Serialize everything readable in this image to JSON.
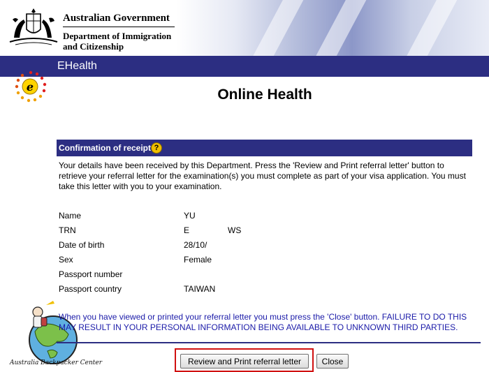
{
  "header": {
    "gov_title": "Australian Government",
    "dept_line1": "Department of Immigration",
    "dept_line2": "and Citizenship"
  },
  "nav": {
    "app_name": "EHealth"
  },
  "page": {
    "title": "Online Health"
  },
  "section": {
    "title": "Confirmation of receipt",
    "help_glyph": "?",
    "intro": "Your details have been received by this Department. Press the 'Review and Print referral letter' button to retrieve your referral letter for the examination(s) you must complete as part of your visa application. You must take this letter with you to your examination."
  },
  "details": [
    {
      "label": "Name",
      "value": "YU",
      "value2": ""
    },
    {
      "label": "TRN",
      "value": "E",
      "value2": "WS"
    },
    {
      "label": "Date of birth",
      "value": "28/10/",
      "value2": ""
    },
    {
      "label": "Sex",
      "value": "Female",
      "value2": ""
    },
    {
      "label": "Passport number",
      "value": "",
      "value2": ""
    },
    {
      "label": "Passport country",
      "value": "TAIWAN",
      "value2": ""
    }
  ],
  "warning": "When you have viewed or printed your referral letter you must press the 'Close' button. FAILURE TO DO THIS MAY RESULT IN YOUR PERSONAL INFORMATION BEING AVAILABLE TO UNKNOWN THIRD PARTIES.",
  "buttons": {
    "review_label": "Review and Print referral letter",
    "close_label": "Close"
  },
  "watermark": {
    "label": "Australia Backpacker Center"
  },
  "colors": {
    "nav_bg": "#2c2e82",
    "warning_text": "#1a1aa8",
    "highlight": "#d01010"
  }
}
